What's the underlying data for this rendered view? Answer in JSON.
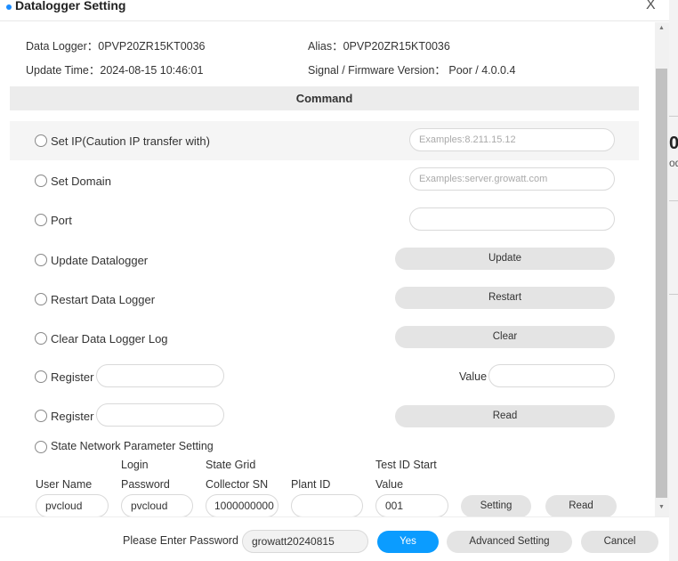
{
  "background": {
    "fragment1": "0",
    "fragment2": "od"
  },
  "dialog": {
    "title": "Datalogger Setting",
    "close": "X"
  },
  "info": {
    "data_logger": "Data Logger：0PVP20ZR15KT0036",
    "alias": "Alias：0PVP20ZR15KT0036",
    "update_time": "Update Time：2024-08-15 10:46:01",
    "signal": "Signal / Firmware Version：  Poor / 4.0.0.4"
  },
  "command_header": "Command",
  "commands": {
    "set_ip": {
      "label": "Set IP(Caution IP transfer with)",
      "placeholder": "Examples:8.211.15.12"
    },
    "set_domain": {
      "label": "Set Domain",
      "placeholder": "Examples:server.growatt.com"
    },
    "port": {
      "label": "Port",
      "value": ""
    },
    "update": {
      "label": "Update Datalogger",
      "button": "Update"
    },
    "restart": {
      "label": "Restart Data Logger",
      "button": "Restart"
    },
    "clear": {
      "label": "Clear Data Logger Log",
      "button": "Clear"
    },
    "register_set": {
      "label": "Register",
      "value_label": "Value"
    },
    "register_read": {
      "label": "Register",
      "button": "Read"
    },
    "state_network": {
      "label": "State Network Parameter Setting"
    }
  },
  "state_grid": {
    "user_name_label": "User Name",
    "user_name": "pvcloud",
    "login_label_1": "Login",
    "login_label_2": "Password",
    "login_password": "pvcloud",
    "sn_label_1": "State Grid",
    "sn_label_2": "Collector SN",
    "sn": "1000000000",
    "plant_label": "Plant ID",
    "plant": "",
    "test_label_1": "Test ID Start",
    "test_label_2": "Value",
    "test": "001",
    "setting_button": "Setting",
    "read_button": "Read"
  },
  "footer": {
    "password_label": "Please Enter Password",
    "password": "growatt20240815",
    "yes": "Yes",
    "advanced": "Advanced Setting",
    "cancel": "Cancel",
    "yes_color": "#0b9cff"
  }
}
